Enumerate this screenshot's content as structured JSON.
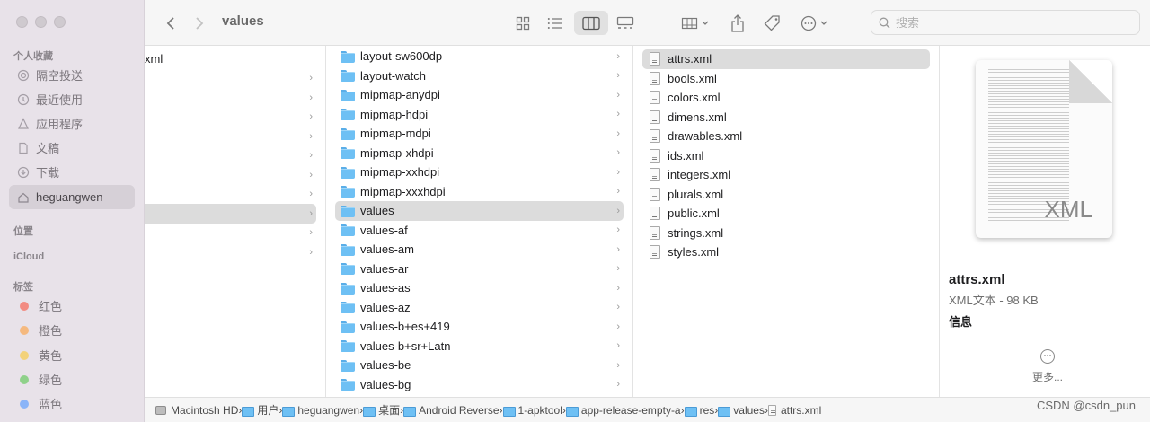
{
  "window": {
    "title": "values"
  },
  "toolbar": {
    "back_icon": "chevron-left-icon",
    "forward_icon": "chevron-right-icon",
    "search_placeholder": "搜索"
  },
  "sidebar": {
    "favorites_header": "个人收藏",
    "favorites": [
      {
        "label": "隔空投送",
        "icon": "airdrop-icon"
      },
      {
        "label": "最近使用",
        "icon": "clock-icon"
      },
      {
        "label": "应用程序",
        "icon": "apps-icon"
      },
      {
        "label": "文稿",
        "icon": "document-icon"
      },
      {
        "label": "下载",
        "icon": "download-icon"
      },
      {
        "label": "heguangwen",
        "icon": "home-icon"
      }
    ],
    "locations_header": "位置",
    "icloud_header": "iCloud",
    "tags_header": "标签",
    "tags": [
      {
        "label": "红色",
        "color": "#f28b82"
      },
      {
        "label": "橙色",
        "color": "#f5b97f"
      },
      {
        "label": "黄色",
        "color": "#f3d27a"
      },
      {
        "label": "绿色",
        "color": "#8fd18a"
      },
      {
        "label": "蓝色",
        "color": "#8ab4f8"
      }
    ]
  },
  "column1": {
    "partial_item": "xml"
  },
  "column2": {
    "items": [
      "layout-sw600dp",
      "layout-watch",
      "mipmap-anydpi",
      "mipmap-hdpi",
      "mipmap-mdpi",
      "mipmap-xhdpi",
      "mipmap-xxhdpi",
      "mipmap-xxxhdpi",
      "values",
      "values-af",
      "values-am",
      "values-ar",
      "values-as",
      "values-az",
      "values-b+es+419",
      "values-b+sr+Latn",
      "values-be",
      "values-bg"
    ],
    "selected": "values"
  },
  "column3": {
    "items": [
      "attrs.xml",
      "bools.xml",
      "colors.xml",
      "dimens.xml",
      "drawables.xml",
      "ids.xml",
      "integers.xml",
      "plurals.xml",
      "public.xml",
      "strings.xml",
      "styles.xml"
    ],
    "selected": "attrs.xml"
  },
  "preview": {
    "thumbnail_label": "XML",
    "name": "attrs.xml",
    "meta": "XML文本 - 98 KB",
    "info_label": "信息",
    "more_label": "更多..."
  },
  "pathbar": [
    {
      "label": "Macintosh HD",
      "icon": "disk-icon"
    },
    {
      "label": "用户",
      "icon": "folder-icon"
    },
    {
      "label": "heguangwen",
      "icon": "folder-icon"
    },
    {
      "label": "桌面",
      "icon": "folder-icon"
    },
    {
      "label": "Android Reverse",
      "icon": "folder-icon"
    },
    {
      "label": "1-apktool",
      "icon": "folder-icon"
    },
    {
      "label": "app-release-empty-a",
      "icon": "folder-icon"
    },
    {
      "label": "res",
      "icon": "folder-icon"
    },
    {
      "label": "values",
      "icon": "folder-icon"
    },
    {
      "label": "attrs.xml",
      "icon": "xml-file-icon"
    }
  ],
  "watermark": "CSDN @csdn_pun"
}
